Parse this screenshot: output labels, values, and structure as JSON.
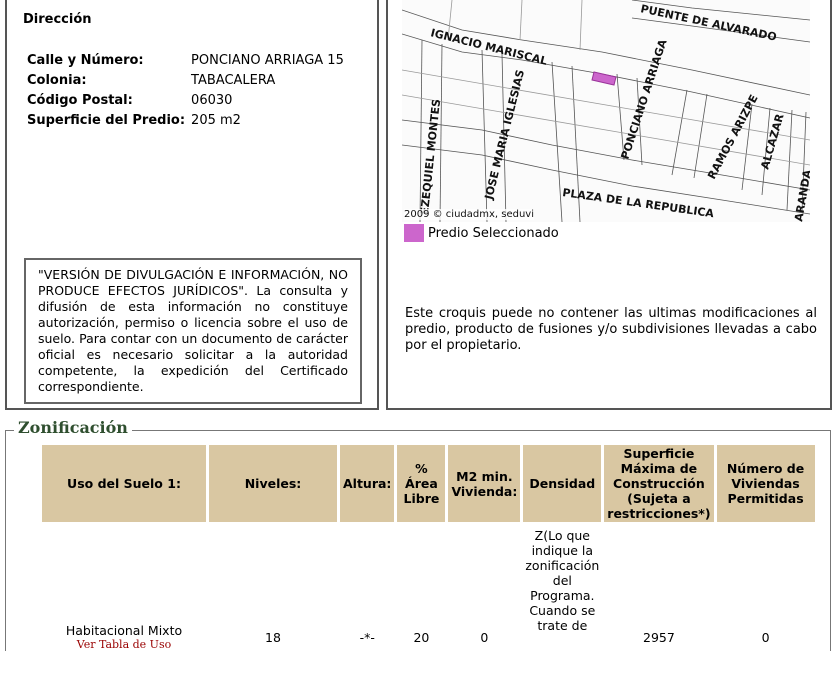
{
  "direccion": {
    "title": "Dirección",
    "rows": [
      {
        "label": "Calle y Número:",
        "value": "PONCIANO ARRIAGA 15"
      },
      {
        "label": "Colonia:",
        "value": "TABACALERA"
      },
      {
        "label": "Código Postal:",
        "value": "06030"
      },
      {
        "label": "Superficie del Predio:",
        "value": "205 m2"
      }
    ],
    "disclaimer": "\"VERSIÓN DE DIVULGACIÓN E INFORMACIÓN, NO PRODUCE EFECTOS JURÍDICOS\". La consulta y difusión de esta información no constituye autorización, permiso o licencia sobre el uso de suelo. Para contar con un documento de carácter oficial es necesario solicitar a la autoridad competente, la expedición del Certificado correspondiente."
  },
  "map": {
    "streets": [
      "PUENTE DE ALVARADO",
      "IGNACIO MARISCAL",
      "EZEQUIEL MONTES",
      "JOSE MARIA IGLESIAS",
      "PONCIANO ARRIAGA",
      "RAMOS ARIZPE",
      "ALCAZAR",
      "PLAZA DE LA REPUBLICA",
      "ARANDA"
    ],
    "credit": "2009 © ciudadmx, seduvi",
    "legend_label": "Predio Seleccionado",
    "legend_color": "#cc66cc",
    "note": "Este croquis puede no contener las ultimas modificaciones al predio, producto de fusiones y/o subdivisiones llevadas a cabo por el propietario."
  },
  "zonificacion": {
    "title": "Zonificación",
    "headers": [
      "Uso del Suelo 1:",
      "Niveles:",
      "Altura:",
      "% Área Libre",
      "M2 min. Vivienda:",
      "Densidad",
      "Superficie Máxima de Construcción (Sujeta a restricciones*)",
      "Número de Viviendas Permitidas"
    ],
    "row": {
      "uso": "Habitacional Mixto",
      "uso_link": "Ver Tabla de Uso",
      "niveles": "18",
      "altura": "-*-",
      "area_libre": "20",
      "m2_min": "0",
      "densidad": "Z(Lo que indique la zonificación del Programa. Cuando se trate de",
      "superficie": "2957",
      "viviendas": "0"
    }
  }
}
